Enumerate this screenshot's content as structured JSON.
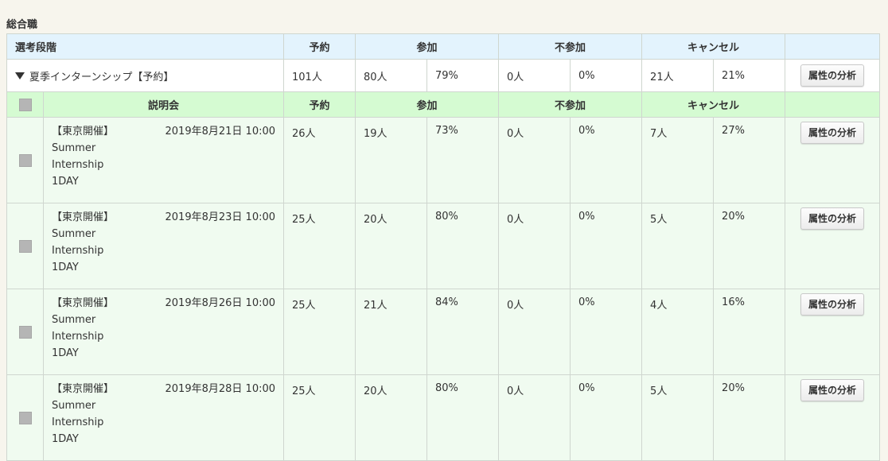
{
  "section_title": "総合職",
  "header": {
    "stage": "選考段階",
    "reservation": "予約",
    "participation": "参加",
    "non_participation": "不参加",
    "cancel": "キャンセル"
  },
  "stage_row": {
    "name": "夏季インターンシップ【予約】",
    "reservation": "101人",
    "participation_count": "80人",
    "participation_pct": "79%",
    "non_participation_count": "0人",
    "non_participation_pct": "0%",
    "cancel_count": "21人",
    "cancel_pct": "21%",
    "button": "属性の分析"
  },
  "subheader": {
    "session": "説明会",
    "reservation": "予約",
    "participation": "参加",
    "non_participation": "不参加",
    "cancel": "キャンセル"
  },
  "sessions": [
    {
      "location": "【東京開催】",
      "name": "Summer Internship 1DAY",
      "date": "2019年8月21日 10:00",
      "reservation": "26人",
      "participation_count": "19人",
      "participation_pct": "73%",
      "non_participation_count": "0人",
      "non_participation_pct": "0%",
      "cancel_count": "7人",
      "cancel_pct": "27%",
      "button": "属性の分析"
    },
    {
      "location": "【東京開催】",
      "name": "Summer Internship 1DAY",
      "date": "2019年8月23日 10:00",
      "reservation": "25人",
      "participation_count": "20人",
      "participation_pct": "80%",
      "non_participation_count": "0人",
      "non_participation_pct": "0%",
      "cancel_count": "5人",
      "cancel_pct": "20%",
      "button": "属性の分析"
    },
    {
      "location": "【東京開催】",
      "name": "Summer Internship 1DAY",
      "date": "2019年8月26日 10:00",
      "reservation": "25人",
      "participation_count": "21人",
      "participation_pct": "84%",
      "non_participation_count": "0人",
      "non_participation_pct": "0%",
      "cancel_count": "4人",
      "cancel_pct": "16%",
      "button": "属性の分析"
    },
    {
      "location": "【東京開催】",
      "name": "Summer Internship 1DAY",
      "date": "2019年8月28日 10:00",
      "reservation": "25人",
      "participation_count": "20人",
      "participation_pct": "80%",
      "non_participation_count": "0人",
      "non_participation_pct": "0%",
      "cancel_count": "5人",
      "cancel_pct": "20%",
      "button": "属性の分析"
    }
  ],
  "colors": {
    "header_bg": "#e3f3fd",
    "subheader_bg": "#d5fbd2",
    "session_bg": "#f0fbf0",
    "page_bg": "#f7f5ed"
  }
}
